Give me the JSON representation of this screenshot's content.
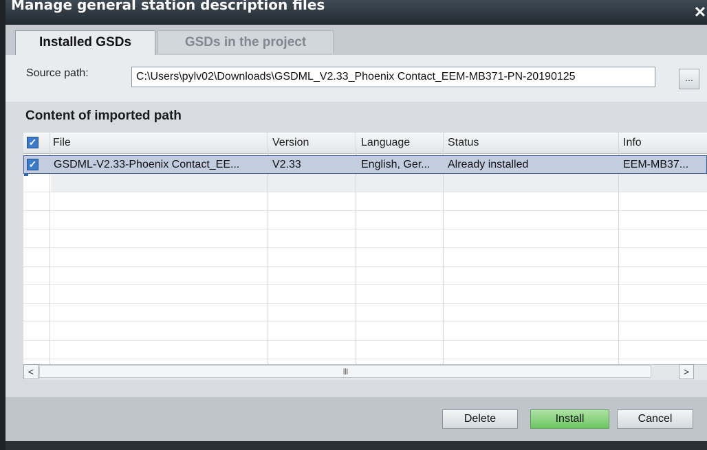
{
  "window": {
    "title": "Manage general station description files",
    "close_glyph": "✕"
  },
  "tabs": [
    {
      "label": "Installed GSDs",
      "active": true
    },
    {
      "label": "GSDs in the project",
      "active": false
    }
  ],
  "source": {
    "label": "Source path:",
    "value": "C:\\Users\\pylv02\\Downloads\\GSDML_V2.33_Phoenix Contact_EEM-MB371-PN-20190125",
    "browse_label": "..."
  },
  "content": {
    "title": "Content of imported path",
    "columns": [
      "File",
      "Version",
      "Language",
      "Status",
      "Info"
    ],
    "rows": [
      {
        "checked": true,
        "file": "GSDML-V2.33-Phoenix Contact_EE...",
        "version": "V2.33",
        "language": "English, Ger...",
        "status": "Already installed",
        "info": "EEM-MB37..."
      }
    ]
  },
  "scrollbar": {
    "left_arrow": "<",
    "right_arrow": ">",
    "thumb_grip": "III"
  },
  "buttons": {
    "delete": "Delete",
    "install": "Install",
    "cancel": "Cancel"
  },
  "colors": {
    "title_bar": "#2b343c",
    "selected_row": "#c3cde0",
    "install_button": "#7dcd73",
    "checkbox": "#3a78c9"
  }
}
